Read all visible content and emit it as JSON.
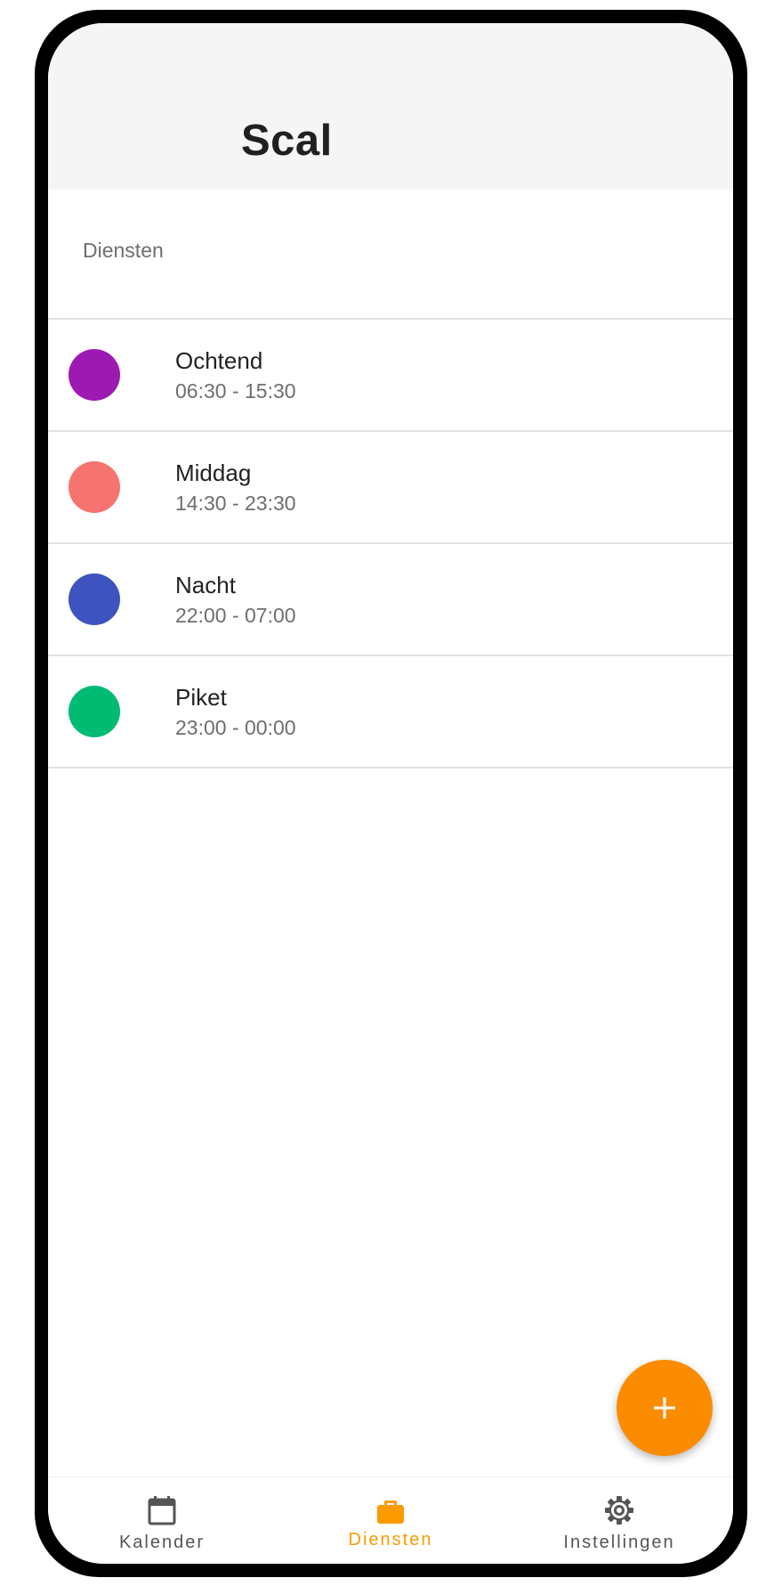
{
  "app": {
    "title": "Scal"
  },
  "section": {
    "label": "Diensten"
  },
  "shifts": [
    {
      "name": "Ochtend",
      "time": "06:30 - 15:30",
      "color": "#9c1ab1"
    },
    {
      "name": "Middag",
      "time": "14:30 - 23:30",
      "color": "#f57470"
    },
    {
      "name": "Nacht",
      "time": "22:00 - 07:00",
      "color": "#3e53c0"
    },
    {
      "name": "Piket",
      "time": "23:00 - 00:00",
      "color": "#00bb72"
    }
  ],
  "fab": {
    "icon": "plus-icon",
    "color": "#fb8c00"
  },
  "bottom_nav": {
    "active_color": "#fb9b00",
    "items": [
      {
        "label": "Kalender",
        "icon": "calendar-icon",
        "active": false
      },
      {
        "label": "Diensten",
        "icon": "briefcase-icon",
        "active": true
      },
      {
        "label": "Instellingen",
        "icon": "gear-icon",
        "active": false
      }
    ]
  }
}
